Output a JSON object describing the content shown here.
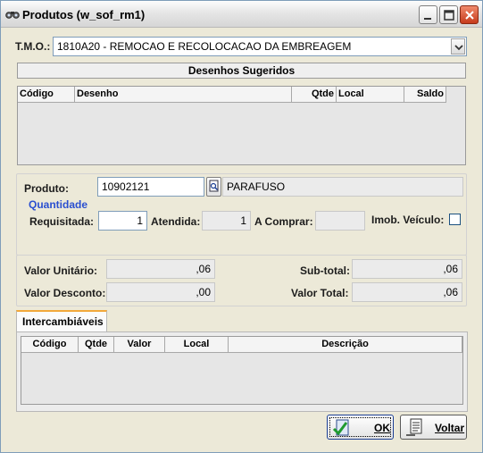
{
  "window": {
    "title": "Produtos (w_sof_rm1)"
  },
  "tmo": {
    "label": "T.M.O.:",
    "value": "1810A20 - REMOCAO E RECOLOCACAO DA EMBREAGEM"
  },
  "desenhos": {
    "title": "Desenhos Sugeridos",
    "columns": [
      "Código",
      "Desenho",
      "Qtde",
      "Local",
      "Saldo"
    ]
  },
  "produto": {
    "label": "Produto:",
    "code": "10902121",
    "name": "PARAFUSO"
  },
  "quantidade": {
    "title": "Quantidade",
    "requisitada_label": "Requisitada:",
    "requisitada_value": "1",
    "atendida_label": "Atendida:",
    "atendida_value": "1",
    "a_comprar_label": "A Comprar:",
    "a_comprar_value": "",
    "imob_label": "Imob. Veículo:",
    "imob_checked": false
  },
  "valores": {
    "unitario_label": "Valor Unitário:",
    "unitario_value": ",06",
    "desconto_label": "Valor Desconto:",
    "desconto_value": ",00",
    "subtotal_label": "Sub-total:",
    "subtotal_value": ",06",
    "total_label": "Valor Total:",
    "total_value": ",06"
  },
  "intercambiaveis": {
    "tab_label": "Intercambiáveis",
    "columns": [
      "Código",
      "Qtde",
      "Valor",
      "Local",
      "Descrição"
    ]
  },
  "buttons": {
    "ok": "OK",
    "voltar": "Voltar"
  },
  "icons": {
    "title": "binoculars-icon",
    "search": "search-doc-icon",
    "ok": "check-doc-icon",
    "voltar": "list-back-icon"
  }
}
